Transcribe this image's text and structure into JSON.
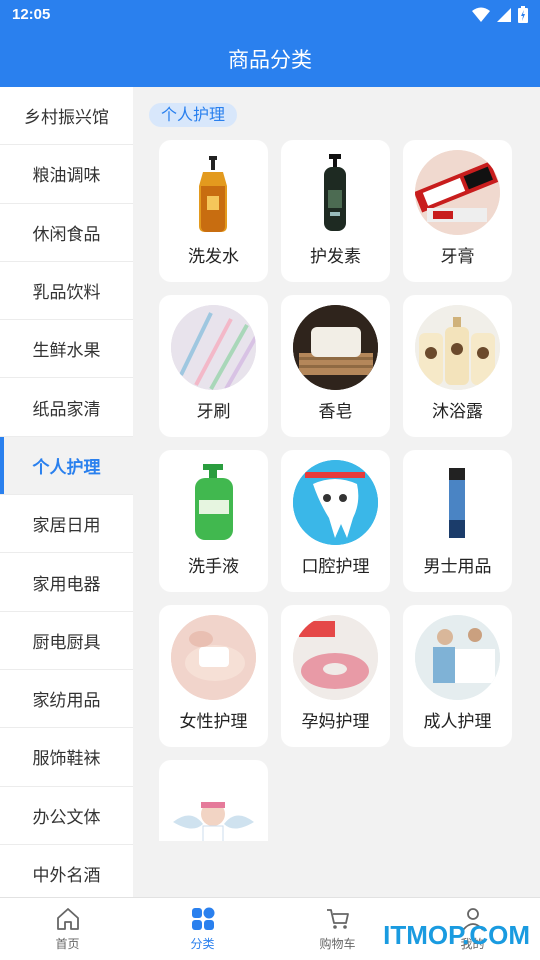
{
  "status": {
    "time": "12:05"
  },
  "header": {
    "title": "商品分类"
  },
  "sidebar": {
    "items": [
      {
        "label": "乡村振兴馆"
      },
      {
        "label": "粮油调味"
      },
      {
        "label": "休闲食品"
      },
      {
        "label": "乳品饮料"
      },
      {
        "label": "生鲜水果"
      },
      {
        "label": "纸品家清"
      },
      {
        "label": "个人护理",
        "active": true
      },
      {
        "label": "家居日用"
      },
      {
        "label": "家用电器"
      },
      {
        "label": "厨电厨具"
      },
      {
        "label": "家纺用品"
      },
      {
        "label": "服饰鞋袜"
      },
      {
        "label": "办公文体"
      },
      {
        "label": "中外名酒"
      }
    ]
  },
  "main": {
    "section_title": "个人护理",
    "categories": [
      {
        "label": "洗发水"
      },
      {
        "label": "护发素"
      },
      {
        "label": "牙膏"
      },
      {
        "label": "牙刷"
      },
      {
        "label": "香皂"
      },
      {
        "label": "沐浴露"
      },
      {
        "label": "洗手液"
      },
      {
        "label": "口腔护理"
      },
      {
        "label": "男士用品"
      },
      {
        "label": "女性护理"
      },
      {
        "label": "孕妈护理"
      },
      {
        "label": "成人护理"
      },
      {
        "label": ""
      }
    ]
  },
  "tabbar": {
    "tabs": [
      {
        "label": "首页",
        "icon": "home-icon"
      },
      {
        "label": "分类",
        "icon": "category-icon",
        "active": true
      },
      {
        "label": "购物车",
        "icon": "cart-icon"
      },
      {
        "label": "我的",
        "icon": "user-icon"
      }
    ]
  },
  "watermark": {
    "text": "ITMOP.COM"
  },
  "colors": {
    "accent": "#2a80ee",
    "background": "#f2f2f2"
  }
}
